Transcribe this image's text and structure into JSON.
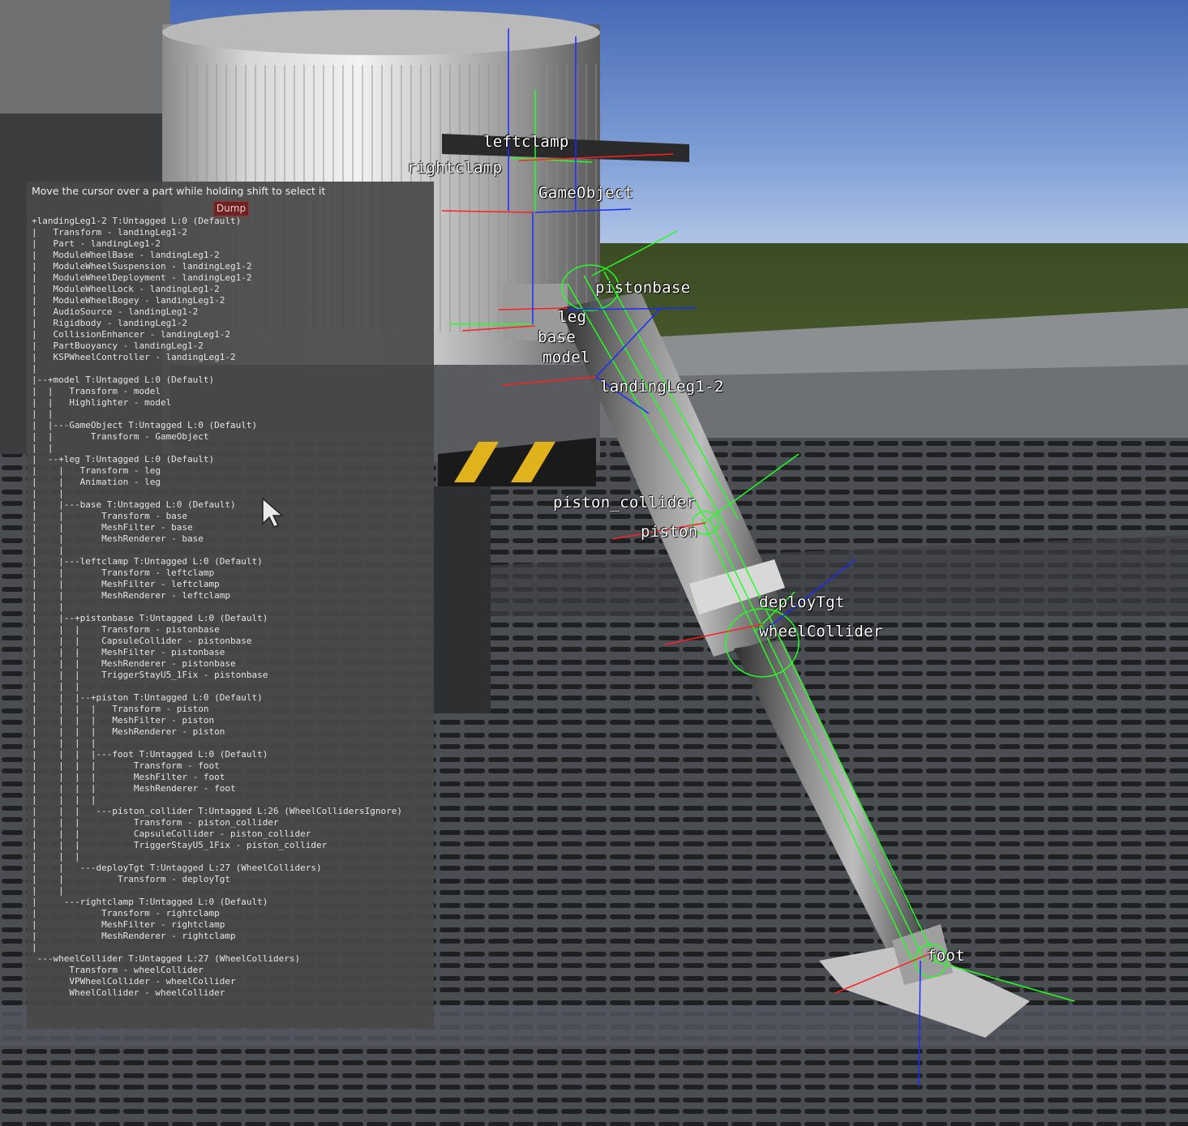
{
  "panel": {
    "title": "Move the cursor over a part while holding shift to select it",
    "dump_label": "Dump",
    "tree_lines": [
      "+landingLeg1-2 T:Untagged L:0 (Default)",
      "|   Transform - landingLeg1-2",
      "|   Part - landingLeg1-2",
      "|   ModuleWheelBase - landingLeg1-2",
      "|   ModuleWheelSuspension - landingLeg1-2",
      "|   ModuleWheelDeployment - landingLeg1-2",
      "|   ModuleWheelLock - landingLeg1-2",
      "|   ModuleWheelBogey - landingLeg1-2",
      "|   AudioSource - landingLeg1-2",
      "|   Rigidbody - landingLeg1-2",
      "|   CollisionEnhancer - landingLeg1-2",
      "|   PartBuoyancy - landingLeg1-2",
      "|   KSPWheelController - landingLeg1-2",
      "|",
      "|--+model T:Untagged L:0 (Default)",
      "|  |   Transform - model",
      "|  |   Highlighter - model",
      "|  |",
      "|  |---GameObject T:Untagged L:0 (Default)",
      "|  |       Transform - GameObject",
      "|  |",
      "|  --+leg T:Untagged L:0 (Default)",
      "|    |   Transform - leg",
      "|    |   Animation - leg",
      "|    |",
      "|    |---base T:Untagged L:0 (Default)",
      "|    |       Transform - base",
      "|    |       MeshFilter - base",
      "|    |       MeshRenderer - base",
      "|    |",
      "|    |---leftclamp T:Untagged L:0 (Default)",
      "|    |       Transform - leftclamp",
      "|    |       MeshFilter - leftclamp",
      "|    |       MeshRenderer - leftclamp",
      "|    |",
      "|    |--+pistonbase T:Untagged L:0 (Default)",
      "|    |  |    Transform - pistonbase",
      "|    |  |    CapsuleCollider - pistonbase",
      "|    |  |    MeshFilter - pistonbase",
      "|    |  |    MeshRenderer - pistonbase",
      "|    |  |    TriggerStayU5_1Fix - pistonbase",
      "|    |  |",
      "|    |  |--+piston T:Untagged L:0 (Default)",
      "|    |  |  |   Transform - piston",
      "|    |  |  |   MeshFilter - piston",
      "|    |  |  |   MeshRenderer - piston",
      "|    |  |  |",
      "|    |  |  |---foot T:Untagged L:0 (Default)",
      "|    |  |  |       Transform - foot",
      "|    |  |  |       MeshFilter - foot",
      "|    |  |  |       MeshRenderer - foot",
      "|    |  |  |",
      "|    |  |   ---piston_collider T:Untagged L:26 (WheelCollidersIgnore)",
      "|    |  |          Transform - piston_collider",
      "|    |  |          CapsuleCollider - piston_collider",
      "|    |  |          TriggerStayU5_1Fix - piston_collider",
      "|    |  |",
      "|    |   ---deployTgt T:Untagged L:27 (WheelColliders)",
      "|    |          Transform - deployTgt",
      "|    |",
      "|     ---rightclamp T:Untagged L:0 (Default)",
      "|            Transform - rightclamp",
      "|            MeshFilter - rightclamp",
      "|            MeshRenderer - rightclamp",
      "|",
      " ---wheelCollider T:Untagged L:27 (WheelColliders)",
      "       Transform - wheelCollider",
      "       VPWheelCollider - wheelCollider",
      "       WheelCollider - wheelCollider"
    ]
  },
  "scene_labels": {
    "leftclamp": "leftclamp",
    "rightclamp": "rightclamp",
    "gameobject": "GameObject",
    "pistonbase": "pistonbase",
    "leg": "leg",
    "base": "base",
    "model": "model",
    "landingleg": "landingLeg1-2",
    "piston_collider": "piston_collider",
    "piston": "piston",
    "deploytgt": "deployTgt",
    "wheelcollider": "wheelCollider",
    "foot": "foot"
  },
  "colors": {
    "sky_top": "#4a6fb8",
    "sky_horizon": "#a9c0e4",
    "grass": "#3d4d23",
    "panel_bg": "#484848",
    "dump_button": "#6e2222",
    "axis_red": "#ff2020",
    "axis_green": "#22ff22",
    "axis_blue": "#1a2cff",
    "label_text": "#ffffff"
  },
  "icons": {
    "cursor": "mouse-pointer-icon"
  }
}
